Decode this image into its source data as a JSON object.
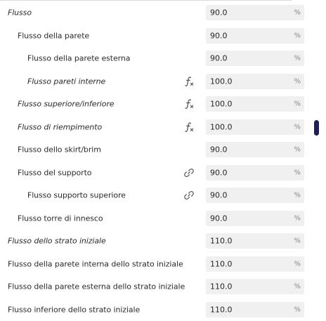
{
  "settings": {
    "rows": [
      {
        "label": "Flusso",
        "value": "90.0",
        "unit": "%",
        "level": 0,
        "italic": true,
        "icon": "none"
      },
      {
        "label": "Flusso della parete",
        "value": "90.0",
        "unit": "%",
        "level": 1,
        "italic": false,
        "icon": "none"
      },
      {
        "label": "Flusso della parete esterna",
        "value": "90.0",
        "unit": "%",
        "level": 2,
        "italic": false,
        "icon": "none"
      },
      {
        "label": "Flusso pareti interne",
        "value": "100.0",
        "unit": "%",
        "level": 2,
        "italic": true,
        "icon": "function-icon"
      },
      {
        "label": "Flusso superiore/inferiore",
        "value": "100.0",
        "unit": "%",
        "level": 1,
        "italic": true,
        "icon": "function-icon"
      },
      {
        "label": "Flusso di riempimento",
        "value": "100.0",
        "unit": "%",
        "level": 1,
        "italic": true,
        "icon": "function-icon"
      },
      {
        "label": "Flusso dello skirt/brim",
        "value": "90.0",
        "unit": "%",
        "level": 1,
        "italic": false,
        "icon": "none"
      },
      {
        "label": "Flusso del supporto",
        "value": "90.0",
        "unit": "%",
        "level": 1,
        "italic": false,
        "icon": "link-icon"
      },
      {
        "label": "Flusso supporto superiore",
        "value": "90.0",
        "unit": "%",
        "level": 2,
        "italic": false,
        "icon": "link-icon"
      },
      {
        "label": "Flusso torre di innesco",
        "value": "90.0",
        "unit": "%",
        "level": 1,
        "italic": false,
        "icon": "none"
      },
      {
        "label": "Flusso dello strato iniziale",
        "value": "110.0",
        "unit": "%",
        "level": 0,
        "italic": true,
        "icon": "none"
      },
      {
        "label": "Flusso della parete interna dello strato iniziale",
        "value": "110.0",
        "unit": "%",
        "level": 0,
        "italic": false,
        "icon": "none"
      },
      {
        "label": "Flusso della parete esterna dello strato iniziale",
        "value": "110.0",
        "unit": "%",
        "level": 0,
        "italic": false,
        "icon": "none"
      },
      {
        "label": "Flusso inferiore dello strato iniziale",
        "value": "110.0",
        "unit": "%",
        "level": 0,
        "italic": false,
        "icon": "none"
      }
    ]
  },
  "scrollbar": {
    "thumb_color": "#1d2153"
  },
  "colors": {
    "field_background": "#f0f0f0",
    "text": "#2b2b2b",
    "unit_text": "#8a8a8a",
    "icon": "#555555"
  }
}
